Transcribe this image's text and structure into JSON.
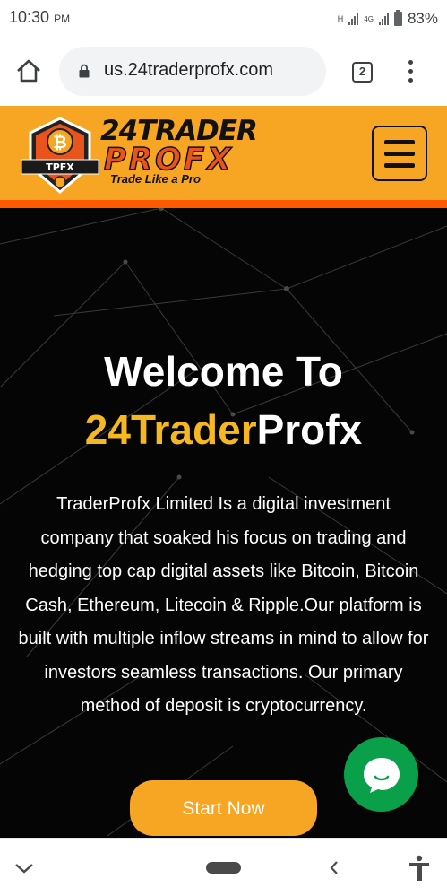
{
  "status_bar": {
    "time": "10:30",
    "ampm": "PM",
    "network_h": "H",
    "network_4g": "4G",
    "battery": "83%"
  },
  "browser": {
    "url": "us.24traderprofx.com",
    "tab_count": "2"
  },
  "site_header": {
    "logo_badge_text": "TPFX",
    "logo_line1": "24TRADER",
    "logo_line2": "PROFX",
    "tagline": "Trade Like a Pro"
  },
  "hero": {
    "title": "Welcome To",
    "brand_part1": "24Trader",
    "brand_part2": "Profx",
    "description": "TraderProfx Limited Is a digital investment company that soaked his focus on trading and hedging top cap digital assets like Bitcoin, Bitcoin Cash, Ethereum, Litecoin & Ripple.Our platform is built with multiple inflow streams in mind to allow for investors seamless transactions. Our primary method of deposit is cryptocurrency.",
    "cta_label": "Start Now"
  },
  "colors": {
    "header_bg": "#f6a623",
    "header_stripe": "#ff5a00",
    "brand_gold": "#f5b820",
    "chat_green": "#0aa04a",
    "hero_bg": "#050505"
  },
  "icons": {
    "browser": [
      "home-icon",
      "lock-icon",
      "tabs-icon",
      "more-vert-icon"
    ],
    "header": [
      "bitcoin-badge-icon",
      "hamburger-menu-icon"
    ],
    "floating": [
      "chat-bubble-icon"
    ],
    "system_nav": [
      "chevron-down-icon",
      "home-pill-icon",
      "back-icon",
      "accessibility-icon"
    ]
  }
}
